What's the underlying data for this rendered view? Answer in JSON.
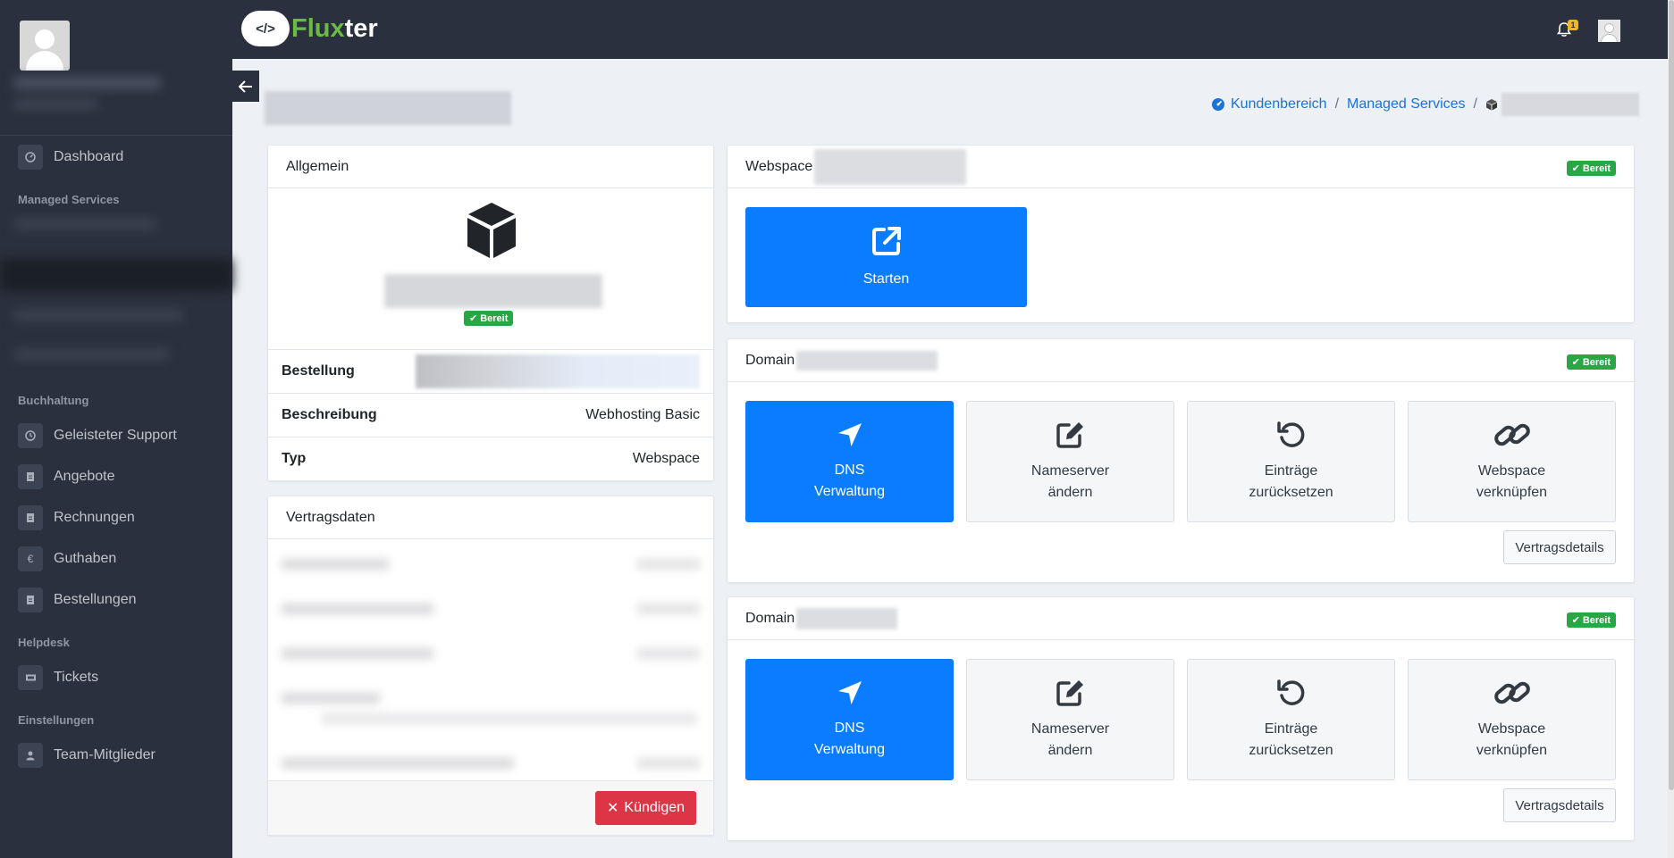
{
  "brand": {
    "logo_badge": "</>",
    "name_part1": "Flux",
    "name_part2": "ter"
  },
  "notifications": {
    "count": "1"
  },
  "sidebar": {
    "items": [
      {
        "label": "Dashboard",
        "icon": "dashboard-icon"
      },
      {
        "label": "Geleisteter Support",
        "icon": "clock-icon"
      },
      {
        "label": "Angebote",
        "icon": "document-icon"
      },
      {
        "label": "Rechnungen",
        "icon": "document-icon"
      },
      {
        "label": "Guthaben",
        "icon": "euro-icon",
        "glyph": "€"
      },
      {
        "label": "Bestellungen",
        "icon": "document-icon"
      },
      {
        "label": "Tickets",
        "icon": "ticket-icon"
      },
      {
        "label": "Team-Mitglieder",
        "icon": "user-icon"
      }
    ],
    "sections": {
      "managed_services": "Managed Services",
      "buchhaltung": "Buchhaltung",
      "helpdesk": "Helpdesk",
      "einstellungen": "Einstellungen"
    }
  },
  "breadcrumb": {
    "home": "Kundenbereich",
    "section": "Managed Services",
    "sep": "/"
  },
  "general_card": {
    "title": "Allgemein",
    "status": "Bereit",
    "rows": [
      {
        "key": "Bestellung",
        "value": ""
      },
      {
        "key": "Beschreibung",
        "value": "Webhosting Basic"
      },
      {
        "key": "Typ",
        "value": "Webspace"
      }
    ]
  },
  "contract_card": {
    "title": "Vertragsdaten",
    "cancel_label": "Kündigen"
  },
  "webspace_card": {
    "title": "Webspace",
    "status": "Bereit",
    "start_label": "Starten"
  },
  "domain_cards": [
    {
      "title": "Domain",
      "status": "Bereit",
      "actions": [
        {
          "line1": "DNS",
          "line2": "Verwaltung"
        },
        {
          "line1": "Nameserver",
          "line2": "ändern"
        },
        {
          "line1": "Einträge",
          "line2": "zurücksetzen"
        },
        {
          "line1": "Webspace",
          "line2": "verknüpfen"
        }
      ],
      "details_label": "Vertragsdetails"
    },
    {
      "title": "Domain",
      "status": "Bereit",
      "actions": [
        {
          "line1": "DNS",
          "line2": "Verwaltung"
        },
        {
          "line1": "Nameserver",
          "line2": "ändern"
        },
        {
          "line1": "Einträge",
          "line2": "zurücksetzen"
        },
        {
          "line1": "Webspace",
          "line2": "verknüpfen"
        }
      ],
      "details_label": "Vertragsdetails"
    }
  ],
  "colors": {
    "primary": "#0a7cff",
    "success": "#28a745",
    "danger": "#dc3545",
    "sidebar": "#2a303d",
    "brand_green": "#6abb46"
  }
}
